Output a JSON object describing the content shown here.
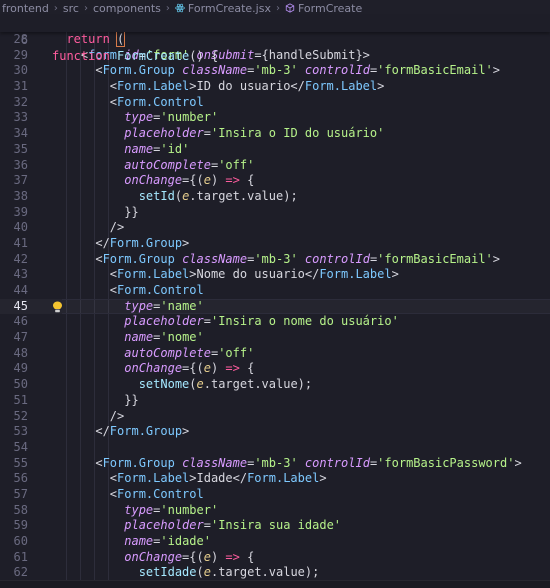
{
  "breadcrumb": {
    "items": [
      "frontend",
      "src",
      "components",
      "FormCreate.jsx",
      "FormCreate"
    ],
    "separator": "›"
  },
  "sticky": {
    "line_number": "6",
    "tokens": [
      {
        "c": "k",
        "t": "function "
      },
      {
        "c": "f",
        "t": "FormCreate"
      },
      {
        "c": "p",
        "t": "() {"
      }
    ]
  },
  "editor": {
    "active_line": 45,
    "lines": [
      {
        "n": "28",
        "tokens": [
          {
            "c": "p",
            "t": "  "
          },
          {
            "c": "k",
            "t": "return "
          },
          {
            "c": "br",
            "t": "(",
            "cursor": true
          }
        ]
      },
      {
        "n": "29",
        "tokens": [
          {
            "c": "p",
            "t": "    <"
          },
          {
            "c": "t",
            "t": "form "
          },
          {
            "c": "a",
            "t": "id"
          },
          {
            "c": "p",
            "t": "="
          },
          {
            "c": "s",
            "t": "'form' "
          },
          {
            "c": "a",
            "t": "onSubmit"
          },
          {
            "c": "p",
            "t": "={handleSubmit}>"
          }
        ]
      },
      {
        "n": "30",
        "tokens": [
          {
            "c": "p",
            "t": "      <"
          },
          {
            "c": "t",
            "t": "Form.Group "
          },
          {
            "c": "a",
            "t": "className"
          },
          {
            "c": "p",
            "t": "="
          },
          {
            "c": "s",
            "t": "'mb-3' "
          },
          {
            "c": "a",
            "t": "controlId"
          },
          {
            "c": "p",
            "t": "="
          },
          {
            "c": "s",
            "t": "'formBasicEmail'"
          },
          {
            "c": "p",
            "t": ">"
          }
        ]
      },
      {
        "n": "31",
        "tokens": [
          {
            "c": "p",
            "t": "        <"
          },
          {
            "c": "t",
            "t": "Form.Label"
          },
          {
            "c": "p",
            "t": ">ID do usuario</"
          },
          {
            "c": "t",
            "t": "Form.Label"
          },
          {
            "c": "p",
            "t": ">"
          }
        ]
      },
      {
        "n": "32",
        "tokens": [
          {
            "c": "p",
            "t": "        <"
          },
          {
            "c": "t",
            "t": "Form.Control"
          }
        ]
      },
      {
        "n": "33",
        "tokens": [
          {
            "c": "p",
            "t": "          "
          },
          {
            "c": "a",
            "t": "type"
          },
          {
            "c": "p",
            "t": "="
          },
          {
            "c": "s",
            "t": "'number'"
          }
        ]
      },
      {
        "n": "34",
        "tokens": [
          {
            "c": "p",
            "t": "          "
          },
          {
            "c": "a",
            "t": "placeholder"
          },
          {
            "c": "p",
            "t": "="
          },
          {
            "c": "s",
            "t": "'Insira o ID do usuário'"
          }
        ]
      },
      {
        "n": "35",
        "tokens": [
          {
            "c": "p",
            "t": "          "
          },
          {
            "c": "a",
            "t": "name"
          },
          {
            "c": "p",
            "t": "="
          },
          {
            "c": "s",
            "t": "'id'"
          }
        ]
      },
      {
        "n": "36",
        "tokens": [
          {
            "c": "p",
            "t": "          "
          },
          {
            "c": "a",
            "t": "autoComplete"
          },
          {
            "c": "p",
            "t": "="
          },
          {
            "c": "s",
            "t": "'off'"
          }
        ]
      },
      {
        "n": "37",
        "tokens": [
          {
            "c": "p",
            "t": "          "
          },
          {
            "c": "a",
            "t": "onChange"
          },
          {
            "c": "p",
            "t": "={("
          },
          {
            "c": "v",
            "t": "e"
          },
          {
            "c": "p",
            "t": ") "
          },
          {
            "c": "k",
            "t": "=>"
          },
          {
            "c": "p",
            "t": " {"
          }
        ]
      },
      {
        "n": "38",
        "tokens": [
          {
            "c": "p",
            "t": "            "
          },
          {
            "c": "f",
            "t": "setId"
          },
          {
            "c": "p",
            "t": "("
          },
          {
            "c": "v",
            "t": "e"
          },
          {
            "c": "p",
            "t": ".target.value);"
          }
        ]
      },
      {
        "n": "39",
        "tokens": [
          {
            "c": "p",
            "t": "          }}"
          }
        ]
      },
      {
        "n": "40",
        "tokens": [
          {
            "c": "p",
            "t": "        />"
          }
        ]
      },
      {
        "n": "41",
        "tokens": [
          {
            "c": "p",
            "t": "      </"
          },
          {
            "c": "t",
            "t": "Form.Group"
          },
          {
            "c": "p",
            "t": ">"
          }
        ]
      },
      {
        "n": "42",
        "tokens": [
          {
            "c": "p",
            "t": "      <"
          },
          {
            "c": "t",
            "t": "Form.Group "
          },
          {
            "c": "a",
            "t": "className"
          },
          {
            "c": "p",
            "t": "="
          },
          {
            "c": "s",
            "t": "'mb-3' "
          },
          {
            "c": "a",
            "t": "controlId"
          },
          {
            "c": "p",
            "t": "="
          },
          {
            "c": "s",
            "t": "'formBasicEmail'"
          },
          {
            "c": "p",
            "t": ">"
          }
        ]
      },
      {
        "n": "43",
        "tokens": [
          {
            "c": "p",
            "t": "        <"
          },
          {
            "c": "t",
            "t": "Form.Label"
          },
          {
            "c": "p",
            "t": ">Nome do usuario</"
          },
          {
            "c": "t",
            "t": "Form.Label"
          },
          {
            "c": "p",
            "t": ">"
          }
        ]
      },
      {
        "n": "44",
        "tokens": [
          {
            "c": "p",
            "t": "        <"
          },
          {
            "c": "t",
            "t": "Form.Control"
          }
        ]
      },
      {
        "n": "45",
        "tokens": [
          {
            "c": "p",
            "t": "          "
          },
          {
            "c": "a",
            "t": "type"
          },
          {
            "c": "p",
            "t": "="
          },
          {
            "c": "s",
            "t": "'name'"
          }
        ]
      },
      {
        "n": "46",
        "tokens": [
          {
            "c": "p",
            "t": "          "
          },
          {
            "c": "a",
            "t": "placeholder"
          },
          {
            "c": "p",
            "t": "="
          },
          {
            "c": "s",
            "t": "'Insira o nome do usuário'"
          }
        ]
      },
      {
        "n": "47",
        "tokens": [
          {
            "c": "p",
            "t": "          "
          },
          {
            "c": "a",
            "t": "name"
          },
          {
            "c": "p",
            "t": "="
          },
          {
            "c": "s",
            "t": "'nome'"
          }
        ]
      },
      {
        "n": "48",
        "tokens": [
          {
            "c": "p",
            "t": "          "
          },
          {
            "c": "a",
            "t": "autoComplete"
          },
          {
            "c": "p",
            "t": "="
          },
          {
            "c": "s",
            "t": "'off'"
          }
        ]
      },
      {
        "n": "49",
        "tokens": [
          {
            "c": "p",
            "t": "          "
          },
          {
            "c": "a",
            "t": "onChange"
          },
          {
            "c": "p",
            "t": "={("
          },
          {
            "c": "v",
            "t": "e"
          },
          {
            "c": "p",
            "t": ") "
          },
          {
            "c": "k",
            "t": "=>"
          },
          {
            "c": "p",
            "t": " {"
          }
        ]
      },
      {
        "n": "50",
        "tokens": [
          {
            "c": "p",
            "t": "            "
          },
          {
            "c": "f",
            "t": "setNome"
          },
          {
            "c": "p",
            "t": "("
          },
          {
            "c": "v",
            "t": "e"
          },
          {
            "c": "p",
            "t": ".target.value);"
          }
        ]
      },
      {
        "n": "51",
        "tokens": [
          {
            "c": "p",
            "t": "          }}"
          }
        ]
      },
      {
        "n": "52",
        "tokens": [
          {
            "c": "p",
            "t": "        />"
          }
        ]
      },
      {
        "n": "53",
        "tokens": [
          {
            "c": "p",
            "t": "      </"
          },
          {
            "c": "t",
            "t": "Form.Group"
          },
          {
            "c": "p",
            "t": ">"
          }
        ]
      },
      {
        "n": "54",
        "tokens": []
      },
      {
        "n": "55",
        "tokens": [
          {
            "c": "p",
            "t": "      <"
          },
          {
            "c": "t",
            "t": "Form.Group "
          },
          {
            "c": "a",
            "t": "className"
          },
          {
            "c": "p",
            "t": "="
          },
          {
            "c": "s",
            "t": "'mb-3' "
          },
          {
            "c": "a",
            "t": "controlId"
          },
          {
            "c": "p",
            "t": "="
          },
          {
            "c": "s",
            "t": "'formBasicPassword'"
          },
          {
            "c": "p",
            "t": ">"
          }
        ]
      },
      {
        "n": "56",
        "tokens": [
          {
            "c": "p",
            "t": "        <"
          },
          {
            "c": "t",
            "t": "Form.Label"
          },
          {
            "c": "p",
            "t": ">Idade</"
          },
          {
            "c": "t",
            "t": "Form.Label"
          },
          {
            "c": "p",
            "t": ">"
          }
        ]
      },
      {
        "n": "57",
        "tokens": [
          {
            "c": "p",
            "t": "        <"
          },
          {
            "c": "t",
            "t": "Form.Control"
          }
        ]
      },
      {
        "n": "58",
        "tokens": [
          {
            "c": "p",
            "t": "          "
          },
          {
            "c": "a",
            "t": "type"
          },
          {
            "c": "p",
            "t": "="
          },
          {
            "c": "s",
            "t": "'number'"
          }
        ]
      },
      {
        "n": "59",
        "tokens": [
          {
            "c": "p",
            "t": "          "
          },
          {
            "c": "a",
            "t": "placeholder"
          },
          {
            "c": "p",
            "t": "="
          },
          {
            "c": "s",
            "t": "'Insira sua idade'"
          }
        ]
      },
      {
        "n": "60",
        "tokens": [
          {
            "c": "p",
            "t": "          "
          },
          {
            "c": "a",
            "t": "name"
          },
          {
            "c": "p",
            "t": "="
          },
          {
            "c": "s",
            "t": "'idade'"
          }
        ]
      },
      {
        "n": "61",
        "tokens": [
          {
            "c": "p",
            "t": "          "
          },
          {
            "c": "a",
            "t": "onChange"
          },
          {
            "c": "p",
            "t": "={("
          },
          {
            "c": "v",
            "t": "e"
          },
          {
            "c": "p",
            "t": ") "
          },
          {
            "c": "k",
            "t": "=>"
          },
          {
            "c": "p",
            "t": " {"
          }
        ]
      },
      {
        "n": "62",
        "tokens": [
          {
            "c": "p",
            "t": "            "
          },
          {
            "c": "f",
            "t": "setIdade"
          },
          {
            "c": "p",
            "t": "("
          },
          {
            "c": "v",
            "t": "e"
          },
          {
            "c": "p",
            "t": ".target.value);"
          }
        ]
      }
    ]
  },
  "icons": {
    "file_icon": "react-atom-icon",
    "symbol_icon": "symbol-cube-icon",
    "hint_icon": "lightbulb-icon"
  },
  "colors": {
    "background": "#1e1e28",
    "keyword": "#ff5c9e",
    "tag": "#7ec9ff",
    "attribute": "#d89bff",
    "string": "#b6f28a",
    "function": "#a5e8ff",
    "lightbulb": "#f4c430"
  }
}
